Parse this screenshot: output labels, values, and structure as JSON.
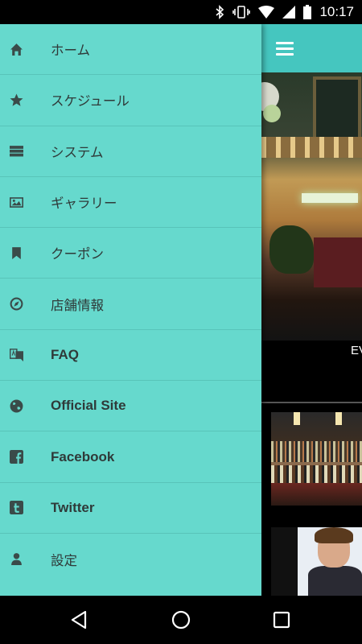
{
  "status_bar": {
    "time": "10:17",
    "icons": [
      "bluetooth-icon",
      "vibrate-icon",
      "wifi-icon",
      "signal-icon",
      "battery-icon"
    ]
  },
  "drawer": {
    "items": [
      {
        "label": "ホーム",
        "icon": "home-icon"
      },
      {
        "label": "スケジュール",
        "icon": "star-icon"
      },
      {
        "label": "システム",
        "icon": "server-icon"
      },
      {
        "label": "ギャラリー",
        "icon": "image-icon"
      },
      {
        "label": "クーポン",
        "icon": "bookmark-icon"
      },
      {
        "label": "店舗情報",
        "icon": "compass-icon"
      },
      {
        "label": "FAQ",
        "icon": "translate-icon"
      },
      {
        "label": "Official Site",
        "icon": "globe-icon"
      },
      {
        "label": "Facebook",
        "icon": "facebook-icon"
      },
      {
        "label": "Twitter",
        "icon": "tumblr-icon"
      },
      {
        "label": "設定",
        "icon": "user-icon"
      }
    ]
  },
  "app": {
    "banner_text": "EV"
  },
  "colors": {
    "drawer_bg": "#66d9cd",
    "appbar_bg": "#45c6bf",
    "icon": "#3a4b49",
    "text": "#2f3a39"
  }
}
